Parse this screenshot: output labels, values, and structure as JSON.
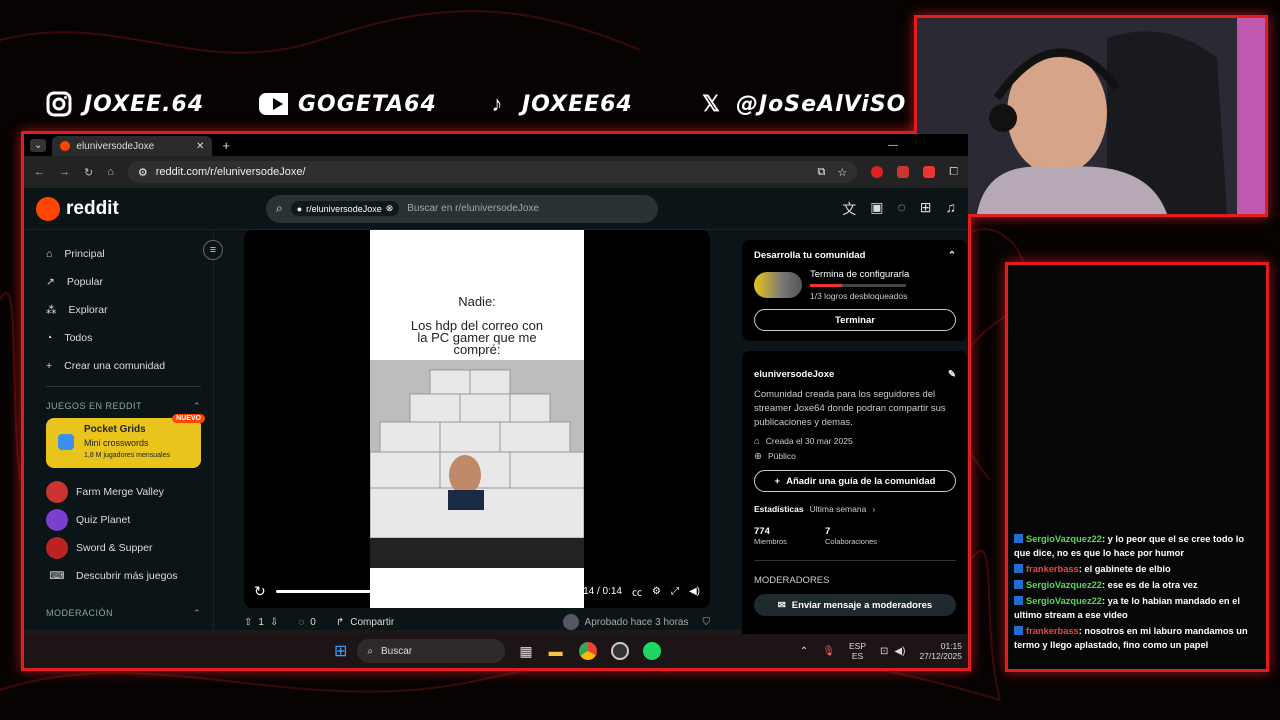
{
  "socials": [
    {
      "icon": "instagram-icon",
      "handle": "JOXEE.64"
    },
    {
      "icon": "youtube-icon",
      "handle": "GOGETA64"
    },
    {
      "icon": "tiktok-icon",
      "handle": "JOXEE64"
    },
    {
      "icon": "x-icon",
      "handle": "@JoSeAlViSO"
    }
  ],
  "browser": {
    "tab_title": "eluniversodeJoxe",
    "new_tab": "+",
    "url": "reddit.com/r/eluniversodeJoxe/"
  },
  "reddit": {
    "logo": "reddit",
    "search_chip": "r/eluniversodeJoxe",
    "search_placeholder": "Buscar en r/eluniversodeJoxe",
    "nav": [
      "Principal",
      "Popular",
      "Explorar",
      "Todos",
      "Crear una comunidad"
    ],
    "games_section": "JUEGOS EN REDDIT",
    "featured_game": {
      "name": "Pocket Grids",
      "badge": "NUEVO",
      "desc": "Mini crosswords",
      "players": "1,8 M jugadores mensuales"
    },
    "games": [
      "Farm Merge Valley",
      "Quiz Planet",
      "Sword & Supper",
      "Descubrir más juegos"
    ],
    "moderation_section": "MODERACIÓN",
    "meme": {
      "line1": "Nadie:",
      "line2": "Los hdp del correo con la PC gamer que me compré:"
    },
    "video_time": "0:14 / 0:14",
    "votes": "1",
    "comments": "0",
    "share": "Compartir",
    "approved": "Aprobado hace 3 horas",
    "develop": {
      "title": "Desarrolla tu comunidad",
      "task": "Termina de configurarla",
      "progress": "1/3 logros desbloqueados",
      "progress_fraction": 0.33,
      "button": "Terminar"
    },
    "about": {
      "name": "eluniversodeJoxe",
      "desc": "Comunidad creada para los seguidores del streamer Joxe64 donde podran compartir sus publicaciones y demas.",
      "created": "Creada el 30 mar 2025",
      "visibility": "Público",
      "guide_button": "Añadir una guía de la comunidad",
      "stats_label": "Estadísticas",
      "stats_period": "Última semana",
      "members": "774",
      "members_label": "Miembros",
      "contribs": "7",
      "contribs_label": "Colaboraciones",
      "mods_label": "MODERADORES",
      "mod_button": "Enviar mensaje a moderadores"
    }
  },
  "taskbar": {
    "search": "Buscar",
    "lang1": "ESP",
    "lang2": "ES",
    "time": "01:15",
    "date": "27/12/2025"
  },
  "chat": [
    {
      "user": "SergioVazquez22",
      "color": "#5bd65b",
      "text": ": y lo peor que el se cree todo lo que dice, no es que lo hace por humor"
    },
    {
      "user": "frankerbass",
      "color": "#e04a4a",
      "text": ": el gabinete de elbio"
    },
    {
      "user": "SergioVazquez22",
      "color": "#5bd65b",
      "text": ": ese es de la otra vez"
    },
    {
      "user": "SergioVazquez22",
      "color": "#5bd65b",
      "text": ": ya te lo habian mandado en el ultimo stream a ese video"
    },
    {
      "user": "frankerbass",
      "color": "#e04a4a",
      "text": ": nosotros en mi laburo mandamos un termo y llego aplastado, fino como un papel"
    }
  ],
  "colors": {
    "accent": "#e01e1e",
    "reddit_orange": "#ff4500"
  }
}
